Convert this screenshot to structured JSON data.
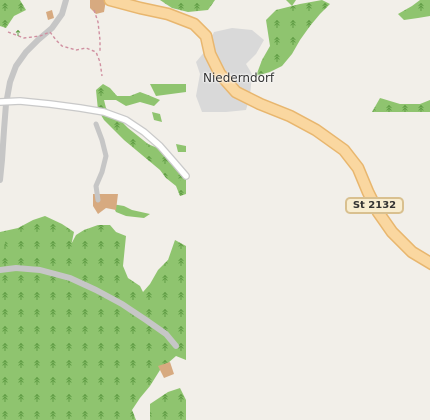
{
  "map": {
    "place": "Niederndorf",
    "road_ref": "St 2132",
    "colors": {
      "background": "#f2efe9",
      "forest": "#8fc46f",
      "forest_edge": "#7fb35f",
      "tree_symbol": "#5d9a42",
      "settlement": "#d9d9d9",
      "building": "#d7aa80",
      "primary_road_fill": "#fad7a0",
      "primary_road_casing": "#e8b66e",
      "track": "#c6c6c6",
      "footpath": "#d08fa0"
    },
    "icons": [
      "tree-symbol"
    ]
  }
}
